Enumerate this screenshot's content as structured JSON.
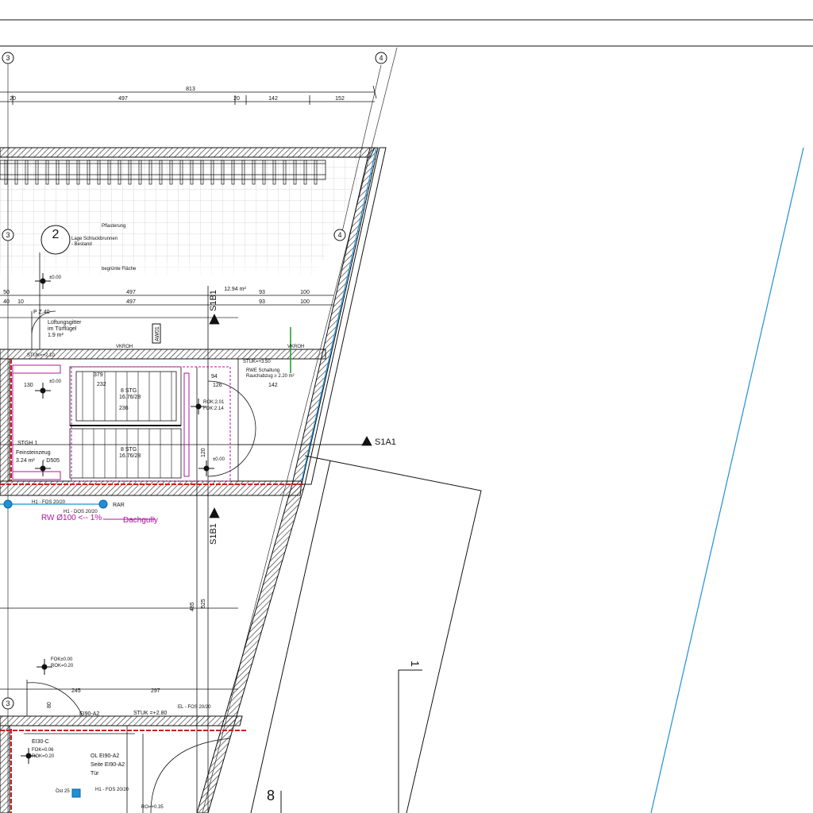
{
  "axes": {
    "grid_3_top": "3",
    "grid_4_top": "4",
    "grid_3_mid": "3",
    "grid_4_mid": "4",
    "grid_3_bottom": "3"
  },
  "dimensions_top": {
    "overall": "813",
    "seg1": "20",
    "seg2": "497",
    "seg3": "20",
    "seg4": "142",
    "seg5": "152"
  },
  "dimensions_mid": {
    "upper": [
      "50",
      "497",
      "93",
      "100"
    ],
    "lower": [
      "40",
      "10",
      "497",
      "93",
      "100"
    ],
    "area": "12.94 m²"
  },
  "labels": {
    "pflasterung": "Pflasterung",
    "schluck": "Lage Schluckbrunnen",
    "bestand": "- Bestand",
    "begruente": "begrünte Fläche",
    "circle_num": "2",
    "pz40": "P Z.40",
    "lueftung1": "Lüftungsgitter",
    "lueftung2": "im Türflügel",
    "lueftung3": "1.9 m²",
    "level_pm": "±0.00",
    "level_pm2": "±0.00",
    "level_pm3": "±0.00",
    "stuk_a": "STUK=+2.10",
    "stuk_b": "STUK=+3.50",
    "vkroh_a": "VKROH",
    "vkroh_b": "VKROH",
    "rwe1": "RWE Schaltung",
    "rwe2": "Rauchabzug ≥ 2.20 m²",
    "aw01": "AW01",
    "rok": "ROK:2.01",
    "fok": "FOK:2.14",
    "stair1": "8 STG",
    "stair1b": "16.76/28",
    "stair2": "8 STG",
    "stair2b": "16.76/28",
    "stgh": "STGH 1",
    "fein1": "Feinsteinzeug",
    "fein2": "3.24 m²",
    "d505": "- D505",
    "dachgully": "Dachgully",
    "rw": "RW Ø100 <-- 1%",
    "rar": "RAR",
    "h1_a": "H1 - FOS 20/20",
    "h1_b": "H1 - DOS 20/20",
    "h1_c": "H1 - FOS 20/20",
    "fok0": "FOK±0.00",
    "rok0": "ROK=0.20",
    "fok06": "FOK=0.06",
    "rok02": "ROK=0.20",
    "ei30": "EI30-C",
    "ei90": "EI90-A2",
    "stuk_c": "STUK =+2.80",
    "el": "EL - FOS 20/20",
    "pz51": "P Z.51",
    "pz52": "P Z.52",
    "pz50": "P Z.50",
    "ol": "OL EI90-A2",
    "seite": "Seite EI90-A2",
    "tuer": "Tür",
    "ok25": "Öst 25",
    "ro35": "RO=+0.35",
    "d245": "245",
    "d297": "297",
    "d485": "485",
    "d525": "525",
    "d236": "236",
    "d232": "232",
    "d379": "379",
    "d142b": "142",
    "d130": "130",
    "d126": "126",
    "d94": "94",
    "d120": "120",
    "d80": "80"
  },
  "section_marks": {
    "s1b1_top": "S1B1",
    "s1b1_bottom": "S1B1",
    "s1a1": "S1A1"
  },
  "sheet": {
    "number_1": "1",
    "number_8": "8"
  },
  "colors": {
    "line": "#111111",
    "blue": "#1e90d8",
    "magenta": "#b0149f",
    "red": "#c81e1e",
    "green": "#1a9a2a",
    "grid": "#c8c8c8"
  }
}
